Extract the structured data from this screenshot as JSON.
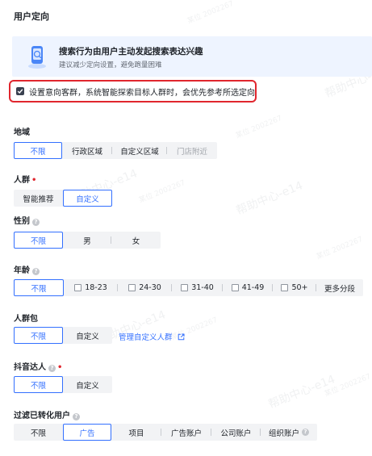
{
  "page": {
    "section_title": "用户定向"
  },
  "banner": {
    "title": "搜索行为由用户主动发起搜索表达兴趣",
    "subtitle": "建议减少定向设置，避免跑量困难"
  },
  "smart_checkbox": {
    "checked": true,
    "label": "设置意向客群，系统智能探索目标人群时，会优先参考所选定向"
  },
  "region": {
    "label": "地域",
    "options": [
      "不限",
      "行政区域",
      "自定义区域",
      "门店附近"
    ],
    "selected": "不限"
  },
  "crowd": {
    "label": "人群",
    "required_mark": "•",
    "options": [
      "智能推荐",
      "自定义"
    ],
    "selected": "自定义"
  },
  "gender": {
    "label": "性别",
    "help": "?",
    "options": [
      "不限",
      "男",
      "女"
    ],
    "selected": "不限"
  },
  "age": {
    "label": "年龄",
    "help": "?",
    "options": [
      "不限",
      "18-23",
      "24-30",
      "31-40",
      "41-49",
      "50+",
      "更多分段"
    ],
    "selected": "不限"
  },
  "crowd_pack": {
    "label": "人群包",
    "options": [
      "不限",
      "自定义"
    ],
    "selected": "不限",
    "manage_link": "管理自定义人群"
  },
  "douyin_creator": {
    "label": "抖音达人",
    "help": "?",
    "required_mark": "•",
    "options": [
      "不限",
      "自定义"
    ],
    "selected": "不限"
  },
  "filter_converted": {
    "label": "过滤已转化用户",
    "help": "?",
    "options": [
      "不限",
      "广告",
      "项目",
      "广告账户",
      "公司账户",
      "组织账户"
    ],
    "selected": "广告"
  },
  "watermark": {
    "texts": [
      "帮助中心-e14",
      "某位 2002267"
    ]
  },
  "colors": {
    "accent": "#3370ff",
    "highlight_border": "#e0262e",
    "banner_bg": "#eef4ff"
  }
}
